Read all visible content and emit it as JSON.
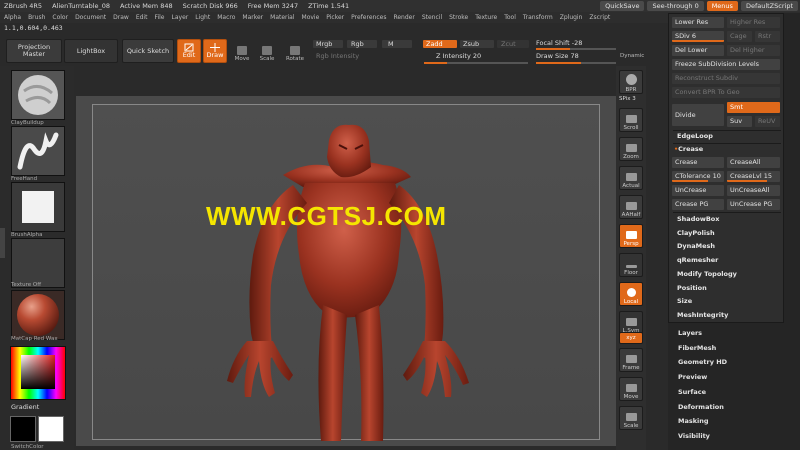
{
  "titlebar": {
    "app": "ZBrush 4R5",
    "doc": "AlienTurntable_08",
    "active_mem": "Active Mem 848",
    "scratch_disk": "Scratch Disk 966",
    "free_mem": "Free Mem 3247",
    "ztime": "ZTime 1.541",
    "quicksave": "QuickSave",
    "see_through": "See-through",
    "see_through_value": "0",
    "menus": "Menus",
    "script": "DefaultZScript"
  },
  "menubar": [
    "Alpha",
    "Brush",
    "Color",
    "Document",
    "Draw",
    "Edit",
    "File",
    "Layer",
    "Light",
    "Macro",
    "Marker",
    "Material",
    "Movie",
    "Picker",
    "Preferences",
    "Render",
    "Stencil",
    "Stroke",
    "Texture",
    "Tool",
    "Transform",
    "Zplugin",
    "Zscript"
  ],
  "coords": "1.1,0.604,0.463",
  "toolbar": {
    "projection_master": "Projection Master",
    "lightbox": "LightBox",
    "quick_sketch": "Quick Sketch",
    "edit": "Edit",
    "draw": "Draw",
    "move": "Move",
    "scale": "Scale",
    "rotate": "Rotate",
    "mrgb": "Mrgb",
    "rgb": "Rgb",
    "m": "M",
    "rgb_intensity": "Rgb Intensity",
    "zadd": "Zadd",
    "zsub": "Zsub",
    "zcut": "Zcut",
    "z_intensity": "Z Intensity 20",
    "focal_shift": "Focal Shift -28",
    "draw_size": "Draw Size 78",
    "dynamic": "Dynamic"
  },
  "leftshelf": {
    "brush": "ClayBuildup",
    "stroke": "FreeHand",
    "alpha": "BrushAlpha",
    "texture": "Texture Off",
    "material": "MatCap Red Wax",
    "gradient": "Gradient",
    "switchcolor": "SwitchColor"
  },
  "watermark": "WWW.CGTSJ.COM",
  "rightcol": {
    "bpr": "BPR",
    "spix": "SPix 3",
    "scroll": "Scroll",
    "zoom": "Zoom",
    "actual": "Actual",
    "aahalf": "AAHalf",
    "persp": "Persp",
    "floor": "Floor",
    "local": "Local",
    "lsym": "L.Sym",
    "xyz": "xyz",
    "frame": "Frame",
    "move": "Move",
    "scale": "Scale"
  },
  "palette": {
    "lower_res": "Lower Res",
    "higher_res": "Higher Res",
    "sdiv": "SDiv 6",
    "cage": "Cage",
    "rstr": "Rstr",
    "del_lower": "Del Lower",
    "del_higher": "Del Higher",
    "freeze_subdiv": "Freeze SubDivision Levels",
    "reconstruct_subdiv": "Reconstruct Subdiv",
    "convert_bpr": "Convert BPR To Geo",
    "divide": "Divide",
    "smt": "Smt",
    "suv": "Suv",
    "reuv": "ReUV",
    "edgeloop": "EdgeLoop",
    "crease_header": "Crease",
    "crease": "Crease",
    "crease_all": "CreaseAll",
    "ctolerance": "CTolerance 10",
    "creaselvl": "CreaseLvl 15",
    "uncrease": "UnCrease",
    "uncrease_all": "UnCreaseAll",
    "crease_pg": "Crease PG",
    "uncrease_pg": "UnCrease PG",
    "sections": [
      "ShadowBox",
      "ClayPolish",
      "DynaMesh",
      "qRemesher",
      "Modify Topology",
      "Position",
      "Size",
      "MeshIntegrity"
    ],
    "outer_sections": [
      "Layers",
      "FiberMesh",
      "Geometry HD",
      "Preview",
      "Surface",
      "Deformation",
      "Masking",
      "Visibility"
    ]
  }
}
